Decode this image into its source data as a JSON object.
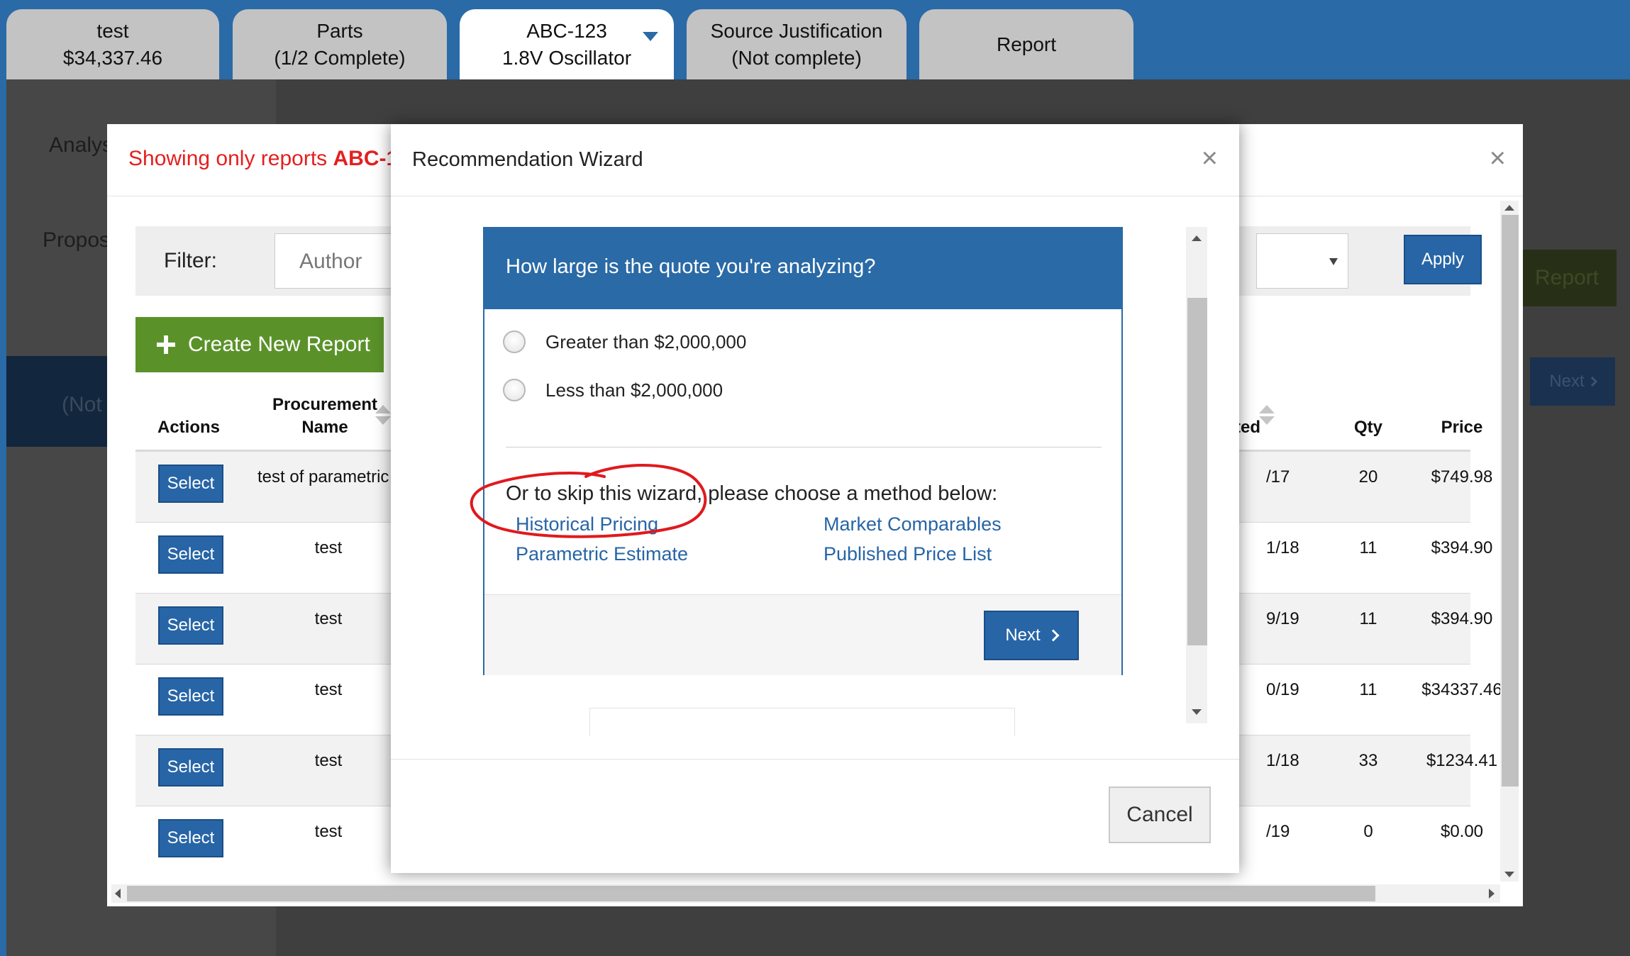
{
  "tabs": [
    {
      "line1": "test",
      "line2": "$34,337.46"
    },
    {
      "line1": "Parts",
      "line2": "(1/2 Complete)"
    },
    {
      "line1": "ABC-123",
      "line2": "1.8V Oscillator"
    },
    {
      "line1": "Source Justification",
      "line2": "(Not complete)"
    },
    {
      "line1": "Report"
    }
  ],
  "background": {
    "label_analysis": "Analys",
    "label_proposal": "Propos",
    "navy_text": "(Not",
    "report_button": "Report",
    "next_button": "Next"
  },
  "reports_modal": {
    "title_prefix": "Showing only reports",
    "title_part": "ABC-1",
    "filter_label": "Filter:",
    "author_placeholder": "Author",
    "apply_label": "Apply",
    "create_label": "Create New Report",
    "headers": {
      "actions": "Actions",
      "procurement_line1": "Procurement",
      "procurement_line2": "Name",
      "date_partial": "ted",
      "qty": "Qty",
      "price": "Price"
    },
    "rows": [
      {
        "action": "Select",
        "name": "test of parametric",
        "date": "/17",
        "qty": "20",
        "price": "$749.98"
      },
      {
        "action": "Select",
        "name": "test",
        "date": "1/18",
        "qty": "11",
        "price": "$394.90"
      },
      {
        "action": "Select",
        "name": "test",
        "date": "9/19",
        "qty": "11",
        "price": "$394.90"
      },
      {
        "action": "Select",
        "name": "test",
        "date": "0/19",
        "qty": "11",
        "price": "$34337.46"
      },
      {
        "action": "Select",
        "name": "test",
        "date": "1/18",
        "qty": "33",
        "price": "$1234.41"
      },
      {
        "action": "Select",
        "name": "test",
        "date": "/19",
        "qty": "0",
        "price": "$0.00"
      }
    ]
  },
  "wizard": {
    "title": "Recommendation Wizard",
    "question": "How large is the quote you're analyzing?",
    "options": [
      "Greater than $2,000,000",
      "Less than $2,000,000"
    ],
    "skip_text": "Or to skip this wizard, please choose a method below:",
    "methods": {
      "historical": "Historical Pricing",
      "market": "Market Comparables",
      "parametric": "Parametric Estimate",
      "published": "Published Price List"
    },
    "next_label": "Next",
    "cancel_label": "Cancel"
  },
  "colors": {
    "brand_blue": "#2a6aa6",
    "button_blue": "#2765a6",
    "create_green": "#5a9229",
    "title_red": "#e41f1f",
    "annotation_red": "#e0191e"
  }
}
